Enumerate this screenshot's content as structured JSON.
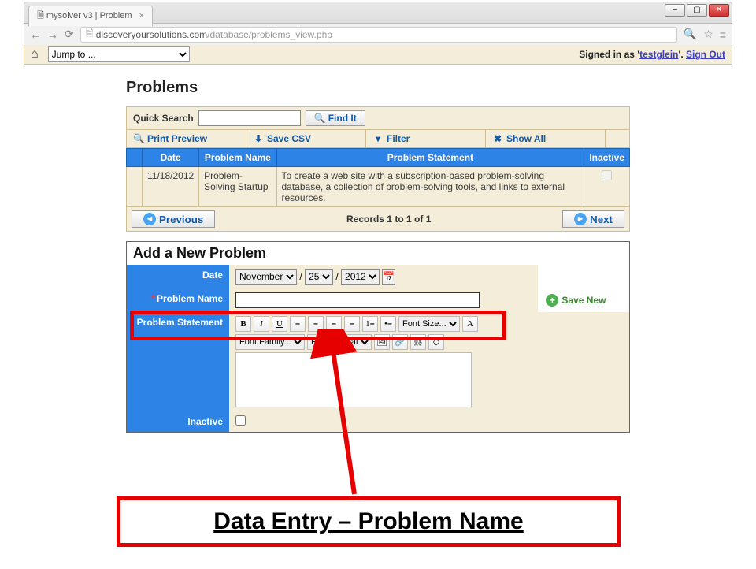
{
  "browser": {
    "tab_title": "mysolver v3 | Problem",
    "url_domain": "discoveryoursolutions.com",
    "url_path": "/database/problems_view.php"
  },
  "topbar": {
    "jump_label": "Jump to ...",
    "signed_in_prefix": "Signed in as '",
    "username": "testglein",
    "signed_in_suffix": "'. ",
    "signout": "Sign Out"
  },
  "page_title": "Problems",
  "quicksearch": {
    "label": "Quick Search",
    "button": "Find It"
  },
  "toolbar": {
    "print_preview": "Print Preview",
    "save_csv": "Save CSV",
    "filter": "Filter",
    "show_all": "Show All"
  },
  "table": {
    "headers": {
      "date": "Date",
      "name": "Problem Name",
      "statement": "Problem Statement",
      "inactive": "Inactive"
    },
    "rows": [
      {
        "date": "11/18/2012",
        "name": "Problem-Solving Startup",
        "statement": "To create a web site with a subscription-based problem-solving database, a collection of problem-solving tools, and links to external resources.",
        "inactive": false
      }
    ]
  },
  "pager": {
    "previous": "Previous",
    "summary": "Records 1 to 1 of 1",
    "next": "Next"
  },
  "add": {
    "heading": "Add a New Problem",
    "date_label": "Date",
    "date_month": "November",
    "date_day": "25",
    "date_year": "2012",
    "name_label": "Problem Name",
    "name_value": "",
    "statement_label": "Problem Statement",
    "inactive_label": "Inactive",
    "save_new": "Save New",
    "font_size": "Font Size...",
    "font_family": "Font Family...",
    "font_format": "Font Format"
  },
  "caption": "Data Entry – Problem Name"
}
